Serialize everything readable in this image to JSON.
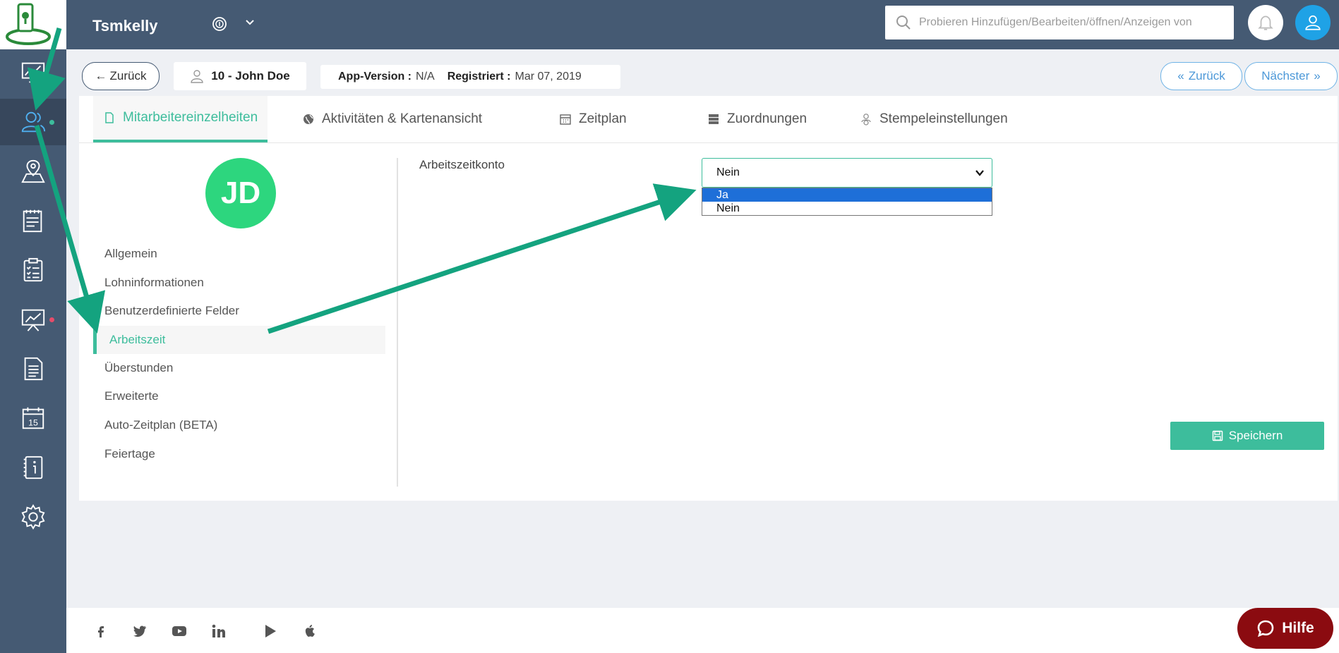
{
  "header": {
    "company": "Tsmkelly",
    "search_placeholder": "Probieren Hinzufügen/Bearbeiten/öffnen/Anzeigen von"
  },
  "subheader": {
    "back_label": "Zurück",
    "employee": "10 - John Doe",
    "app_version_label": "App-Version :",
    "app_version_value": "N/A",
    "registered_label": "Registriert :",
    "registered_value": "Mar 07, 2019",
    "prev_label": "Zurück",
    "next_label": "Nächster"
  },
  "tabs": [
    {
      "label": "Mitarbeitereinzelheiten",
      "icon": "document-icon",
      "active": true
    },
    {
      "label": "Aktivitäten & Kartenansicht",
      "icon": "globe-icon",
      "active": false
    },
    {
      "label": "Zeitplan",
      "icon": "calendar-icon",
      "active": false
    },
    {
      "label": "Zuordnungen",
      "icon": "server-icon",
      "active": false
    },
    {
      "label": "Stempeleinstellungen",
      "icon": "fingerprint-user-icon",
      "active": false
    }
  ],
  "profile": {
    "initials": "JD"
  },
  "menu": [
    "Allgemein",
    "Lohninformationen",
    "Benutzerdefinierte Felder",
    "Arbeitszeit",
    "Überstunden",
    "Erweiterte",
    "Auto-Zeitplan (BETA)",
    "Feiertage"
  ],
  "active_menu_index": 3,
  "form": {
    "field_label": "Arbeitszeitkonto",
    "selected_value": "Nein",
    "options": [
      "Ja",
      "Nein"
    ],
    "highlighted_option": "Ja",
    "save_label": "Speichern"
  },
  "sidebar": {
    "icons": [
      "dashboard-icon",
      "users-icon",
      "map-pin-icon",
      "clipboard-icon",
      "checklist-icon",
      "presentation-chart-icon",
      "report-document-icon",
      "calendar-15-icon",
      "info-book-icon",
      "gear-icon"
    ],
    "calendar_day": "15",
    "active_index": 1
  },
  "footer": {
    "social": [
      "facebook-icon",
      "twitter-icon",
      "youtube-icon",
      "linkedin-icon",
      "play-store-icon",
      "apple-icon"
    ],
    "help_label": "Hilfe"
  },
  "colors": {
    "sidebar": "#455a73",
    "accent": "#3dbd9c",
    "link_blue": "#4c98d8",
    "help_red": "#8b0b10",
    "dropdown_highlight": "#1e6fd8"
  }
}
